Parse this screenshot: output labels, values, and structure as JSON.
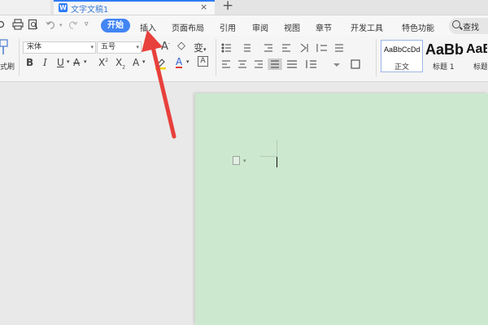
{
  "document_tab": {
    "title": "文字文稿1",
    "icon": "W",
    "close": "×",
    "new_tab": "+"
  },
  "menu": {
    "active": "开始",
    "items": [
      "插入",
      "页面布局",
      "引用",
      "审阅",
      "视图",
      "章节",
      "开发工具",
      "特色功能"
    ],
    "search_label": "查找"
  },
  "ribbon": {
    "font_name": "宋体",
    "font_size": "五号",
    "format_painter_label": "式刷",
    "styles": [
      {
        "preview": "AaBbCcDd",
        "name": "正文"
      },
      {
        "preview": "AaBb",
        "name": "标题 1"
      },
      {
        "preview": "AaB",
        "name": "标题"
      }
    ]
  },
  "colors": {
    "accent": "#4285f4",
    "page_background": "#cce8cf",
    "annotation_arrow": "#e8403c"
  }
}
